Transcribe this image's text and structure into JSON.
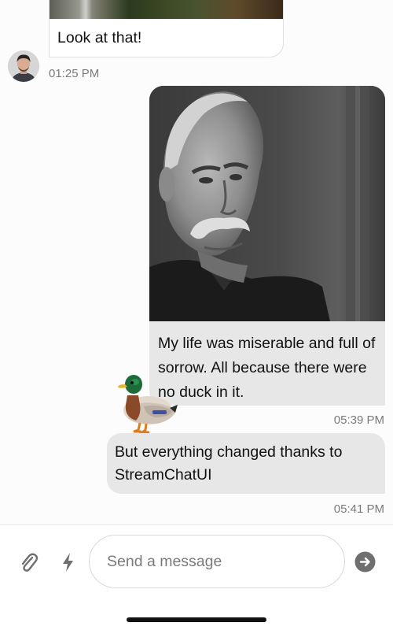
{
  "messages": [
    {
      "id": "incoming",
      "text": "Look at that!",
      "time": "01:25 PM",
      "has_image": true
    },
    {
      "id": "outgoing-image",
      "text": "My life was miserable and full of sorrow. All because there were no duck in it.",
      "time": "05:39 PM",
      "has_image": true,
      "reaction_icon": "duck-emoji"
    },
    {
      "id": "outgoing-text",
      "text": "But everything changed thanks to StreamChatUI",
      "time": "05:41 PM"
    }
  ],
  "composer": {
    "placeholder": "Send a message",
    "attach_icon": "paperclip-icon",
    "commands_icon": "lightning-icon",
    "send_icon": "send-arrow-icon"
  },
  "colors": {
    "background": "#fcfcfc",
    "outgoing_bubble": "#e7e7e7",
    "incoming_bubble": "#ffffff",
    "timestamp": "#7a7a7a"
  }
}
